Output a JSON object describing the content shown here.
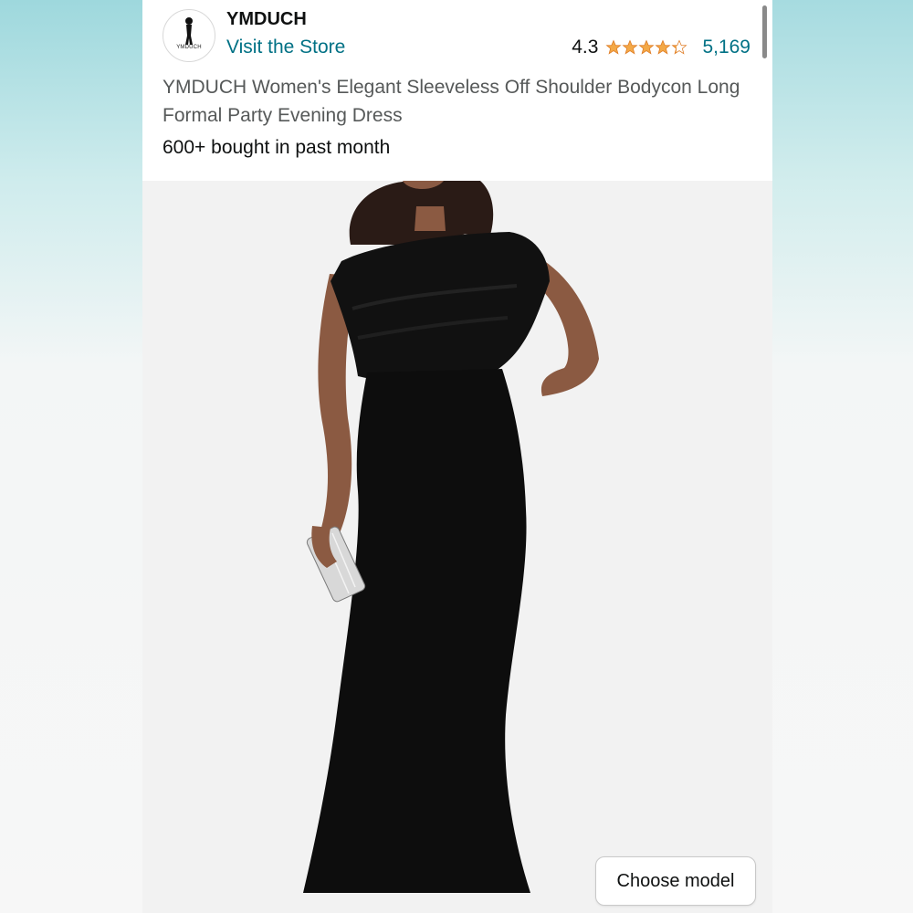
{
  "store": {
    "name": "YMDUCH",
    "logo_text": "YMDUCH",
    "visit_label": "Visit the Store"
  },
  "rating": {
    "value": "4.3",
    "stars": 4.3,
    "count": "5,169",
    "star_color": "#f3a847"
  },
  "product": {
    "title": "YMDUCH Women's Elegant Sleeveless Off Shoulder Bodycon Long Formal Party Evening Dress",
    "bought_text": "600+ bought in past month",
    "image_icon": "product-photo-woman-black-dress"
  },
  "actions": {
    "choose_model_label": "Choose model"
  },
  "colors": {
    "link": "#007185",
    "text": "#0f1111",
    "muted": "#565959"
  }
}
